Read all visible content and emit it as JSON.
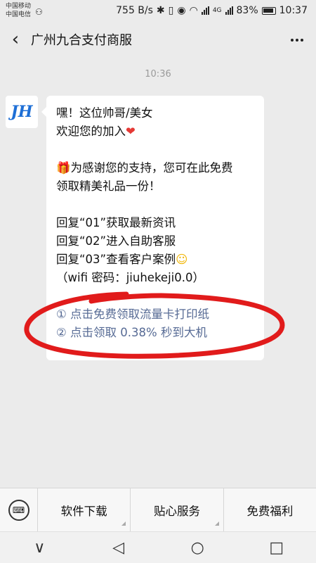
{
  "status": {
    "carrier1": "中国移动",
    "carrier2": "中国电信",
    "speed": "755 B/s",
    "network": "4G",
    "battery": "83%",
    "time": "10:37"
  },
  "header": {
    "title": "广州九合支付商服",
    "back_icon": "chevron-left-icon",
    "more_icon": "more-dots-icon"
  },
  "chat": {
    "timestamp": "10:36",
    "avatar_text": "JH",
    "lines": {
      "l1": "嘿！这位帅哥/美女",
      "l2": "欢迎您的加入",
      "l3": "为感谢您的支持，您可在此免费",
      "l4": "领取精美礼品一份！",
      "l5": "回复“01”获取最新资讯",
      "l6": "回复“02”进入自助客服",
      "l7": "回复“03”查看客户案例",
      "l8": "（wifi 密码：jiuhekeji0.0）",
      "link1": "① 点击免费领取流量卡打印纸",
      "link2": "② 点击领取 0.38% 秒到大机"
    }
  },
  "menu": {
    "items": [
      "软件下载",
      "贴心服务",
      "免费福利"
    ]
  },
  "nav": {
    "back": "∨",
    "home": "◁",
    "circle": "○",
    "square": "□"
  },
  "colors": {
    "link": "#576b95",
    "annotation": "#e11b1b",
    "brand": "#1e6fd6"
  }
}
